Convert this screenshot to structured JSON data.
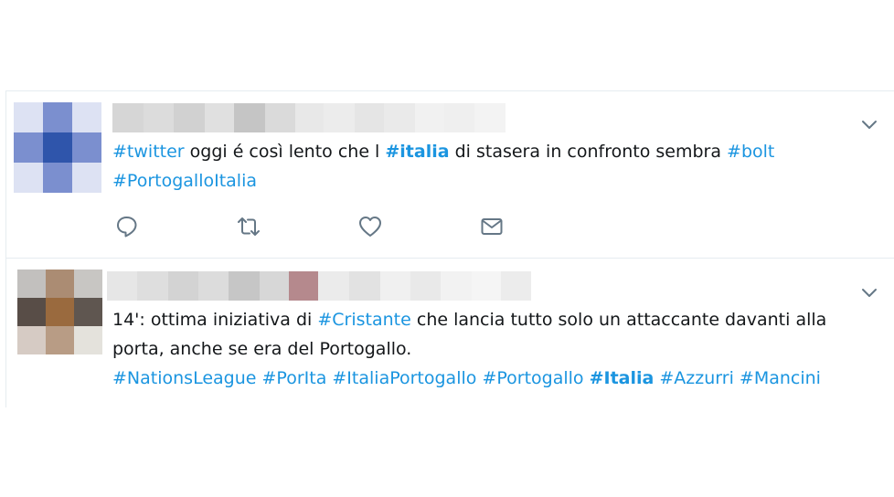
{
  "tweets": [
    {
      "avatar_colors": [
        "#dde2f3",
        "#7b8fcf",
        "#dde2f3",
        "#7b8fcf",
        "#2f55ab",
        "#7b8fcf",
        "#dde2f3",
        "#7b8fcf",
        "#dde2f3"
      ],
      "name_blur_colors": [
        "#d6d6d6",
        "#dcdcdc",
        "#d1d1d1",
        "#e0e0e0",
        "#c5c5c5",
        "#dadada",
        "#e8e8e8",
        "#ececec",
        "#e5e5e5",
        "#eaeaea",
        "#f1f1f1",
        "#efefef",
        "#f3f3f3"
      ],
      "segments": [
        {
          "text": "#twitter",
          "kind": "tag"
        },
        {
          "text": " oggi é così lento che l ",
          "kind": "plain"
        },
        {
          "text": "#italia",
          "kind": "tag-bold"
        },
        {
          "text": " di stasera in confronto sembra ",
          "kind": "plain"
        },
        {
          "text": "#bolt",
          "kind": "tag"
        },
        {
          "text": "\n",
          "kind": "break"
        },
        {
          "text": "#PortogalloItalia",
          "kind": "tag"
        }
      ],
      "actions": [
        "reply-icon",
        "retweet-icon",
        "like-icon",
        "direct-message-icon"
      ]
    },
    {
      "avatar_colors": [
        "#c2c0be",
        "#ab8c73",
        "#c8c6c3",
        "#584d47",
        "#9a6a3e",
        "#5f5650",
        "#d6cbc4",
        "#b89c85",
        "#e4e2dc"
      ],
      "name_blur_colors": [
        "#e6e6e6",
        "#dedede",
        "#d3d3d3",
        "#dcdcdc",
        "#c6c6c6",
        "#d7d7d7",
        "#b5898d",
        "#ebebeb",
        "#e2e2e2",
        "#f0f0f0",
        "#e9e9e9",
        "#f2f2f2",
        "#f5f5f5",
        "#ececec"
      ],
      "segments": [
        {
          "text": "14': ottima iniziativa di ",
          "kind": "plain"
        },
        {
          "text": "#Cristante",
          "kind": "tag"
        },
        {
          "text": " che lancia tutto solo un attaccante davanti alla",
          "kind": "plain"
        },
        {
          "text": "\n",
          "kind": "break"
        },
        {
          "text": "porta, anche se era del Portogallo.",
          "kind": "plain"
        },
        {
          "text": "\n",
          "kind": "break"
        },
        {
          "text": "#NationsLeague",
          "kind": "tag"
        },
        {
          "text": " ",
          "kind": "plain"
        },
        {
          "text": "#PorIta",
          "kind": "tag"
        },
        {
          "text": " ",
          "kind": "plain"
        },
        {
          "text": "#ItaliaPortogallo",
          "kind": "tag"
        },
        {
          "text": " ",
          "kind": "plain"
        },
        {
          "text": "#Portogallo",
          "kind": "tag"
        },
        {
          "text": " ",
          "kind": "plain"
        },
        {
          "text": "#Italia",
          "kind": "tag-bold"
        },
        {
          "text": " ",
          "kind": "plain"
        },
        {
          "text": "#Azzurri",
          "kind": "tag"
        },
        {
          "text": " ",
          "kind": "plain"
        },
        {
          "text": "#Mancini",
          "kind": "tag"
        }
      ],
      "actions": []
    }
  ],
  "colors": {
    "link": "#1b95e0",
    "text": "#14171a",
    "icon": "#657786",
    "border": "#e6ecf0"
  }
}
